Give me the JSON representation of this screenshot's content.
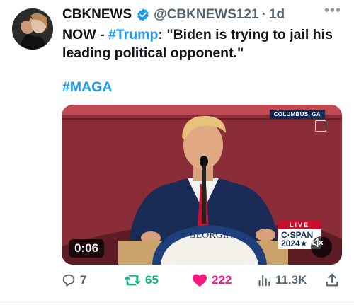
{
  "tweet": {
    "author_name": "CBKNEWS",
    "handle": "@CBKNEWS121",
    "separator": "·",
    "time": "1d",
    "more_icon": "ellipsis-icon",
    "text_prefix": "NOW - ",
    "text_hashtag": "#Trump",
    "text_body": ": \"Biden is trying to jail his leading political opponent.\"",
    "hashtag2": "#MAGA"
  },
  "media": {
    "location_tag": "COLUMBUS, GA",
    "duration": "0:06",
    "live_label": "LIVE",
    "network_line1": "C·SPAN",
    "network_line2": "2024★",
    "podium_text": "GEORGIA",
    "mute_icon": "speaker-muted-icon"
  },
  "actions": {
    "replies": "7",
    "retweets": "65",
    "likes": "222",
    "views": "11.3K"
  },
  "colors": {
    "link": "#1d9bf0",
    "retweet": "#00ba7c",
    "like": "#f91880",
    "muted": "#536471",
    "backdrop_red": "#8e2f3a"
  }
}
